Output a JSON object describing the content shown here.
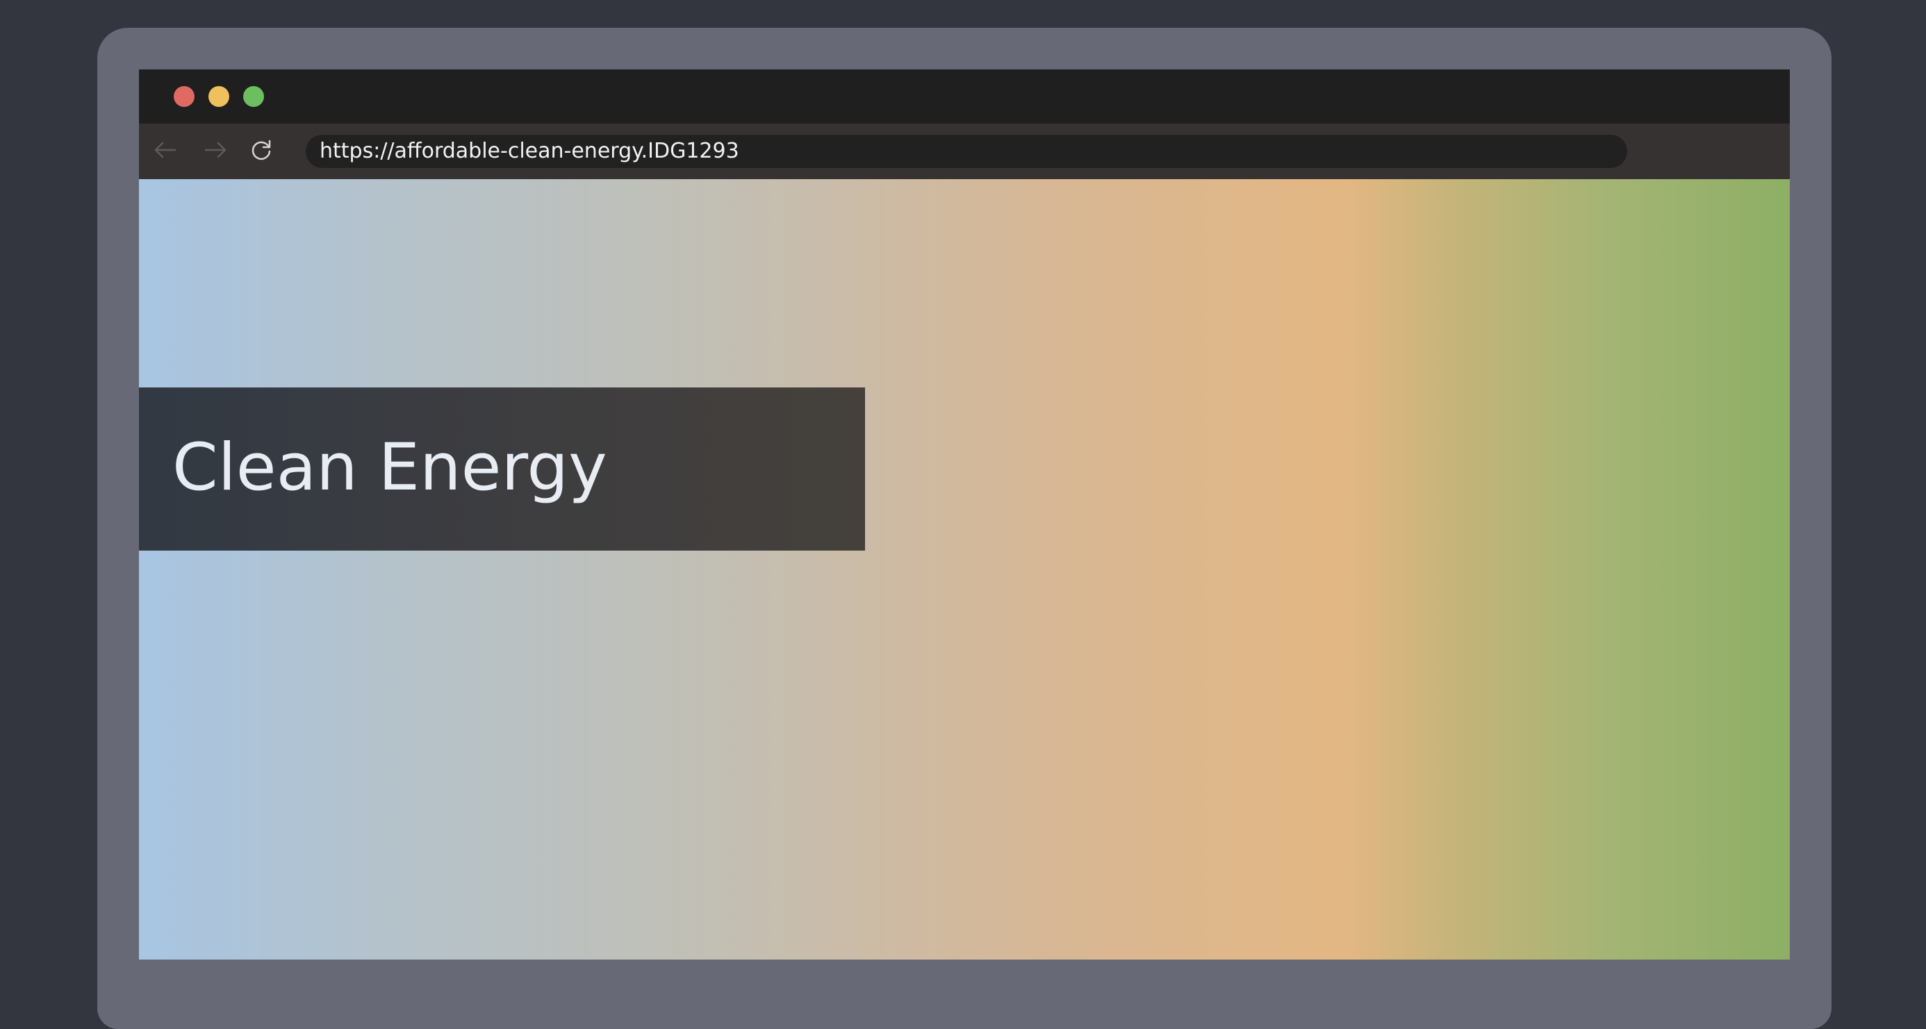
{
  "browser": {
    "window_controls": {
      "close_color": "#df6a62",
      "minimize_color": "#efc15c",
      "maximize_color": "#6cbf5e"
    },
    "toolbar": {
      "back_icon": "arrow-left-icon",
      "forward_icon": "arrow-right-icon",
      "reload_icon": "reload-icon"
    },
    "address_bar": {
      "url": "https://affordable-clean-energy.IDG1293"
    }
  },
  "page": {
    "hero_title": "Clean Energy",
    "background_gradient": [
      "#a8c5e2",
      "#c2bfb4",
      "#e3b783",
      "#8daf65"
    ]
  }
}
